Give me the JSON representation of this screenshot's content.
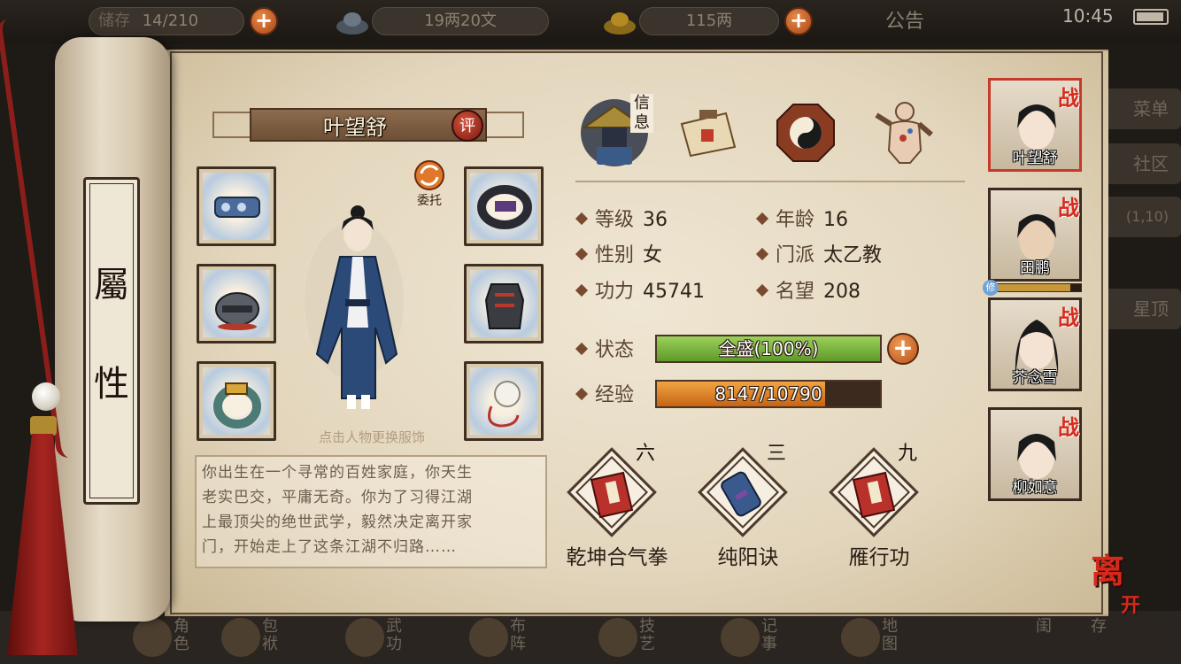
{
  "topbar": {
    "storage_label": "储存",
    "storage_value": "14/210",
    "silver": "19两20文",
    "gold": "115两",
    "notice": "公告",
    "time": "10:45"
  },
  "background_menu": {
    "menu": "菜单",
    "community": "社区",
    "coords": "(1,10)",
    "summit": "星顶"
  },
  "bottom_nav": [
    "角色",
    "包袱",
    "武功",
    "布阵",
    "技艺",
    "记事",
    "地图",
    "闺",
    "存"
  ],
  "side_tab": {
    "char1": "屬",
    "char2": "性"
  },
  "character": {
    "name": "叶望舒",
    "rate_label": "评",
    "entrust_label": "委托",
    "change_outfit_hint": "点击人物更换服饰",
    "bio_lines": [
      "你出生在一个寻常的百姓家庭，你天生",
      "老实巴交，平庸无奇。你为了习得江湖",
      "上最顶尖的绝世武学，毅然决定离开家",
      "门，开始走上了这条江湖不归路……"
    ]
  },
  "tabs": {
    "info_label": "信息",
    "info_icon": "straw-hat-portrait-icon",
    "letter_icon": "letter-icon",
    "bagua_icon": "bagua-icon",
    "meridian_icon": "meridian-body-icon"
  },
  "stats": {
    "level_label": "等级",
    "level_value": "36",
    "age_label": "年龄",
    "age_value": "16",
    "gender_label": "性别",
    "gender_value": "女",
    "sect_label": "门派",
    "sect_value": "太乙教",
    "power_label": "功力",
    "power_value": "45741",
    "fame_label": "名望",
    "fame_value": "208",
    "status_label": "状态",
    "status_value": "全盛(100%)",
    "status_fraction": 1.0,
    "exp_label": "经验",
    "exp_value": "8147/10790",
    "exp_fraction": 0.755
  },
  "skills": [
    {
      "name": "乾坤合气拳",
      "level": "六",
      "icon": "red-book-icon"
    },
    {
      "name": "纯阳诀",
      "level": "三",
      "icon": "scroll-icon"
    },
    {
      "name": "雁行功",
      "level": "九",
      "icon": "red-book-icon"
    }
  ],
  "party": [
    {
      "name": "叶望舒",
      "badge": "战"
    },
    {
      "name": "田鹏",
      "badge": "战",
      "cultivate_label": "修",
      "cultivate_fraction": 0.88
    },
    {
      "name": "芥念雪",
      "badge": "战"
    },
    {
      "name": "柳如意",
      "badge": "战"
    }
  ],
  "leave": {
    "char1": "离",
    "char2": "开"
  },
  "colors": {
    "status_bar": "#7cb342",
    "exp_bar": "#e0801e",
    "accent_red": "#d42a1c",
    "paper": "#e9dfca"
  }
}
